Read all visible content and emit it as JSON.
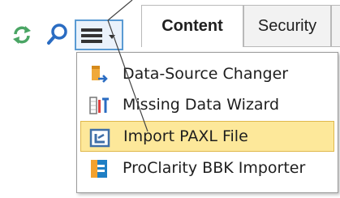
{
  "toolbar": {
    "icons": [
      "refresh-icon",
      "search-icon",
      "menu-icon",
      "chevron-down-icon"
    ]
  },
  "tabs": [
    {
      "label": "Content",
      "active": true
    },
    {
      "label": "Security",
      "active": false
    }
  ],
  "menu": {
    "items": [
      {
        "label": "Data-Source Changer",
        "icon": "data-source-changer-icon",
        "highlighted": false
      },
      {
        "label": "Missing Data Wizard",
        "icon": "missing-data-wizard-icon",
        "highlighted": false
      },
      {
        "label": "Import PAXL File",
        "icon": "import-paxl-icon",
        "highlighted": true
      },
      {
        "label": "ProClarity BBK Importer",
        "icon": "proclarity-importer-icon",
        "highlighted": false
      }
    ]
  },
  "colors": {
    "highlight": "#fde89a",
    "highlight_border": "#e0b84c",
    "button_border": "#5a9bd3",
    "refresh_green": "#4aa564",
    "search_blue": "#2a6cc2"
  }
}
